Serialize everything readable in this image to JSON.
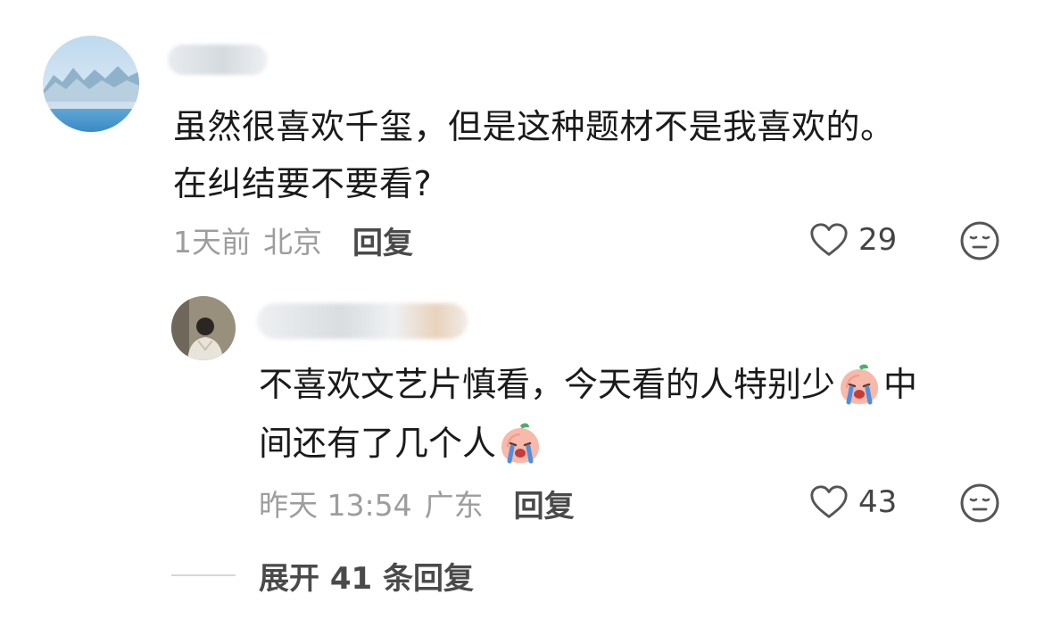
{
  "comment": {
    "text_line1": "虽然很喜欢千玺，但是这种题材不是我喜欢的。",
    "text_line2": "在纠结要不要看?",
    "time": "1天前",
    "location": "北京",
    "reply_label": "回复",
    "like_count": "29",
    "avatar_icon": "landscape-avatar",
    "like_icon": "heart-outline-icon",
    "dislike_icon": "neutral-face-icon"
  },
  "reply": {
    "text_line1_part1": "不喜欢文艺片慎看，今天看的人特别少",
    "text_line1_part2": "中",
    "text_line2": "间还有了几个人",
    "emoji_icon": "crying-peach-emoji",
    "time": "昨天 13:54",
    "location": "广东",
    "reply_label": "回复",
    "like_count": "43"
  },
  "expand": {
    "label": "展开 41 条回复"
  },
  "colors": {
    "text_primary": "#1a1a1a",
    "text_meta": "#9d9d9d",
    "text_action": "#4a4a4a"
  }
}
